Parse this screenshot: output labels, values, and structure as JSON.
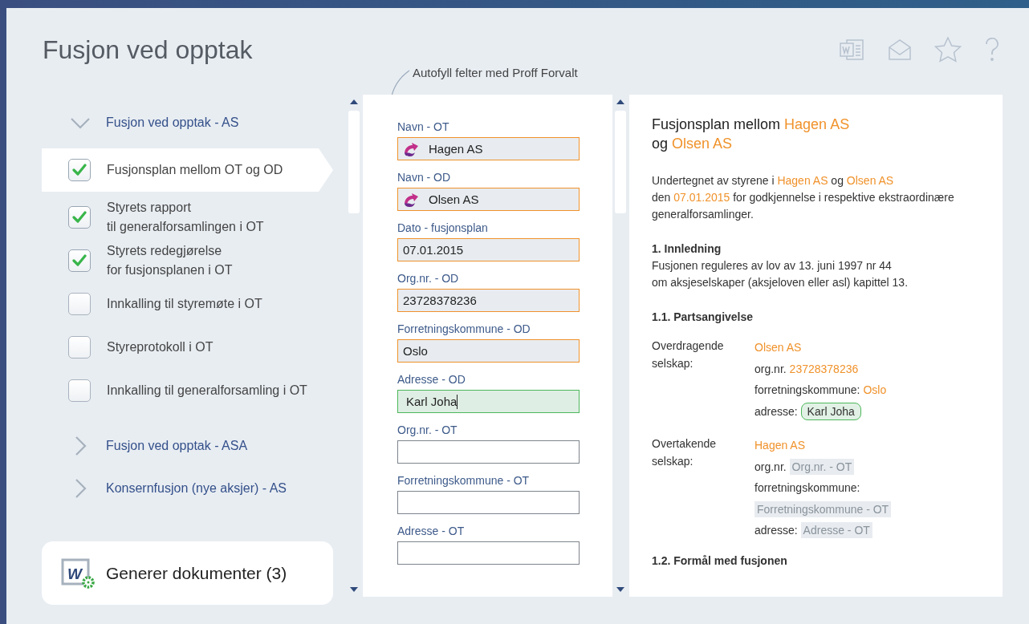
{
  "header": {
    "title": "Fusjon ved opptak",
    "hint": "Autofyll felter med Proff Forvalt"
  },
  "sidebar": {
    "groups": [
      {
        "label": "Fusjon ved opptak - AS",
        "expanded": true,
        "items": [
          {
            "lines": [
              "Fusjonsplan mellom OT og OD"
            ],
            "checked": true,
            "selected": true
          },
          {
            "lines": [
              "Styrets rapport",
              "til generalforsamlingen i OT"
            ],
            "checked": true,
            "selected": false
          },
          {
            "lines": [
              "Styrets redegjørelse",
              "for fusjonsplanen i OT"
            ],
            "checked": true,
            "selected": false
          },
          {
            "lines": [
              "Innkalling til styremøte i OT"
            ],
            "checked": false,
            "selected": false
          },
          {
            "lines": [
              "Styreprotokoll i OT"
            ],
            "checked": false,
            "selected": false
          },
          {
            "lines": [
              "Innkalling til generalforsamling i OT"
            ],
            "checked": false,
            "selected": false
          }
        ]
      },
      {
        "label": "Fusjon ved opptak - ASA",
        "expanded": false
      },
      {
        "label": "Konsernfusjon (nye aksjer) - AS",
        "expanded": false
      }
    ],
    "generate_button": {
      "icon_letter": "W",
      "label": "Generer dokumenter (3)"
    }
  },
  "form": {
    "fields": [
      {
        "label": "Navn - OT",
        "value": "Hagen AS",
        "autofilled": true,
        "focused": false,
        "logo": true
      },
      {
        "label": "Navn - OD",
        "value": "Olsen AS",
        "autofilled": true,
        "focused": false,
        "logo": true
      },
      {
        "label": "Dato - fusjonsplan",
        "value": "07.01.2015",
        "autofilled": true,
        "focused": false
      },
      {
        "label": "Org.nr. - OD",
        "value": "23728378236",
        "autofilled": true,
        "focused": false
      },
      {
        "label": "Forretningskommune - OD",
        "value": "Oslo",
        "autofilled": true,
        "focused": false
      },
      {
        "label": "Adresse - OD",
        "value": "Karl Joha",
        "autofilled": false,
        "focused": true
      },
      {
        "label": "Org.nr. - OT",
        "autofilled": false,
        "focused": false
      },
      {
        "label": "Forretningskommune - OT",
        "autofilled": false,
        "focused": false
      },
      {
        "label": "Adresse - OT",
        "autofilled": false,
        "focused": false
      }
    ]
  },
  "document": {
    "title_lines": [
      [
        {
          "text": "Fusjonsplan mellom ",
          "kind": "plain"
        },
        {
          "text": "Hagen AS",
          "kind": "value"
        }
      ],
      [
        {
          "text": "og ",
          "kind": "plain"
        },
        {
          "text": "Olsen AS",
          "kind": "value"
        }
      ]
    ],
    "blocks": [
      {
        "kind": "paragraph",
        "lines": [
          [
            {
              "text": "Undertegnet av styrene i ",
              "kind": "plain"
            },
            {
              "text": "Hagen AS",
              "kind": "value"
            },
            {
              "text": " og ",
              "kind": "plain"
            },
            {
              "text": "Olsen AS",
              "kind": "value"
            }
          ],
          [
            {
              "text": "den ",
              "kind": "plain"
            },
            {
              "text": "07.01.2015",
              "kind": "value"
            },
            {
              "text": " for godkjennelse i respektive ekstraordinære",
              "kind": "plain"
            }
          ],
          [
            {
              "text": "generalforsamlinger.",
              "kind": "plain"
            }
          ]
        ]
      },
      {
        "kind": "heading",
        "text": "1. Innledning"
      },
      {
        "kind": "paragraph",
        "lines": [
          [
            {
              "text": "Fusjonen reguleres av lov av 13. juni 1997 nr 44",
              "kind": "plain"
            }
          ],
          [
            {
              "text": "om aksjeselskaper (aksjeloven eller asl) kapittel 13.",
              "kind": "plain"
            }
          ]
        ]
      },
      {
        "kind": "heading",
        "text": "1.1. Partsangivelse"
      },
      {
        "kind": "party",
        "label_lines": [
          "Overdragende",
          "selskap:"
        ],
        "rows": [
          [
            {
              "text": "Olsen AS",
              "kind": "value"
            }
          ],
          [
            {
              "text": "org.nr. ",
              "kind": "plain"
            },
            {
              "text": "23728378236",
              "kind": "value"
            }
          ],
          [
            {
              "text": "forretningskommune: ",
              "kind": "plain"
            },
            {
              "text": "Oslo",
              "kind": "value"
            }
          ],
          [
            {
              "text": "adresse: ",
              "kind": "plain"
            },
            {
              "text": "Karl Joha",
              "kind": "editing"
            }
          ]
        ]
      },
      {
        "kind": "party",
        "label_lines": [
          "Overtakende",
          "selskap:"
        ],
        "rows": [
          [
            {
              "text": "Hagen AS",
              "kind": "value"
            }
          ],
          [
            {
              "text": "org.nr. ",
              "kind": "plain"
            },
            {
              "text": "Org.nr. - OT",
              "kind": "pending"
            }
          ],
          [
            {
              "text": "forretningskommune: ",
              "kind": "plain"
            },
            {
              "text": "Forretningskommune - OT",
              "kind": "pending"
            }
          ],
          [
            {
              "text": "adresse: ",
              "kind": "plain"
            },
            {
              "text": "Adresse - OT",
              "kind": "pending"
            }
          ]
        ]
      },
      {
        "kind": "heading",
        "text": "1.2. Formål med fusjonen"
      }
    ]
  }
}
